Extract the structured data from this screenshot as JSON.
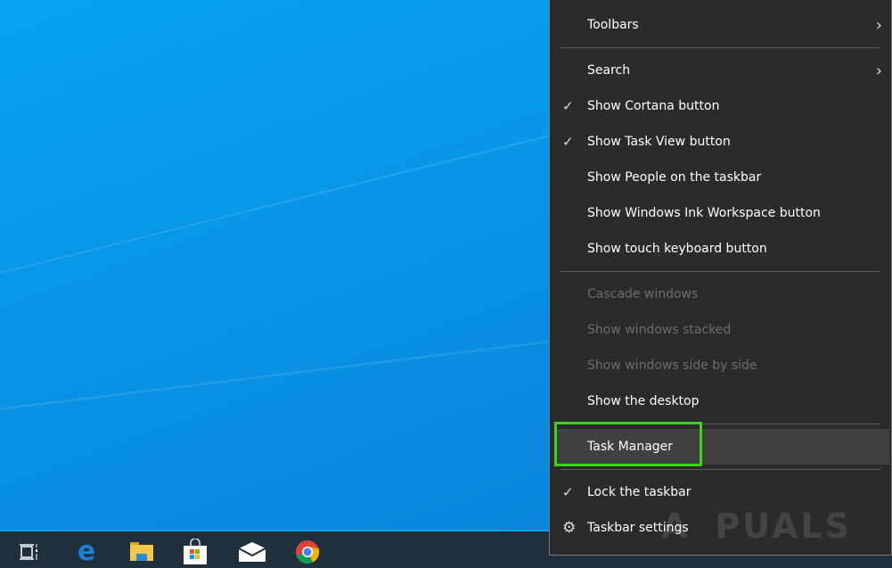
{
  "menu": {
    "toolbars": "Toolbars",
    "search": "Search",
    "show_cortana": "Show Cortana button",
    "show_task_view": "Show Task View button",
    "show_people": "Show People on the taskbar",
    "show_ink": "Show Windows Ink Workspace button",
    "show_touch_keyboard": "Show touch keyboard button",
    "cascade": "Cascade windows",
    "stacked": "Show windows stacked",
    "side_by_side": "Show windows side by side",
    "show_desktop": "Show the desktop",
    "task_manager": "Task Manager",
    "lock_taskbar": "Lock the taskbar",
    "taskbar_settings": "Taskbar settings",
    "check_glyph": "✓",
    "chevron_glyph": "›"
  },
  "watermark": "A PUALS",
  "colors": {
    "highlight": "#3fd21b",
    "menu_bg": "#2b2b2b",
    "taskbar": "#1f2f3b"
  }
}
